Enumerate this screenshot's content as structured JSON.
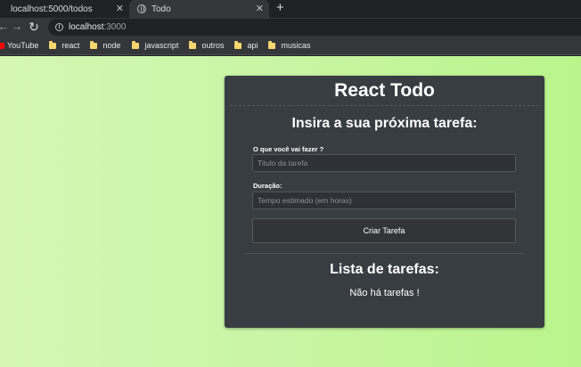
{
  "browser": {
    "tabs": [
      {
        "label": "localhost:5000/todos",
        "close": "✕"
      },
      {
        "label": "Todo",
        "close": "✕"
      }
    ],
    "new_tab": "+",
    "nav": {
      "back": "←",
      "forward": "→",
      "reload": "↻"
    },
    "address": {
      "host": "localhost",
      "port": ":3000"
    },
    "bookmarks": [
      "YouTube",
      "react",
      "node",
      "javascript",
      "outros",
      "api",
      "musicas"
    ]
  },
  "app": {
    "title": "React Todo",
    "form": {
      "heading": "Insira a sua próxima tarefa:",
      "task_label": "O que você vai fazer ?",
      "task_placeholder": "Titulo da tarefa",
      "duration_label": "Duração:",
      "duration_placeholder": "Tempo estimado (em horas)",
      "submit_label": "Criar Tarefa"
    },
    "list": {
      "heading": "Lista de tarefas:",
      "empty_message": "Não há tarefas !"
    }
  },
  "colors": {
    "card_bg": "#383d42",
    "page_gradient_start": "#d4f7b5",
    "page_gradient_end": "#b9f58c",
    "bookmark_folder": "#f6d66f"
  }
}
